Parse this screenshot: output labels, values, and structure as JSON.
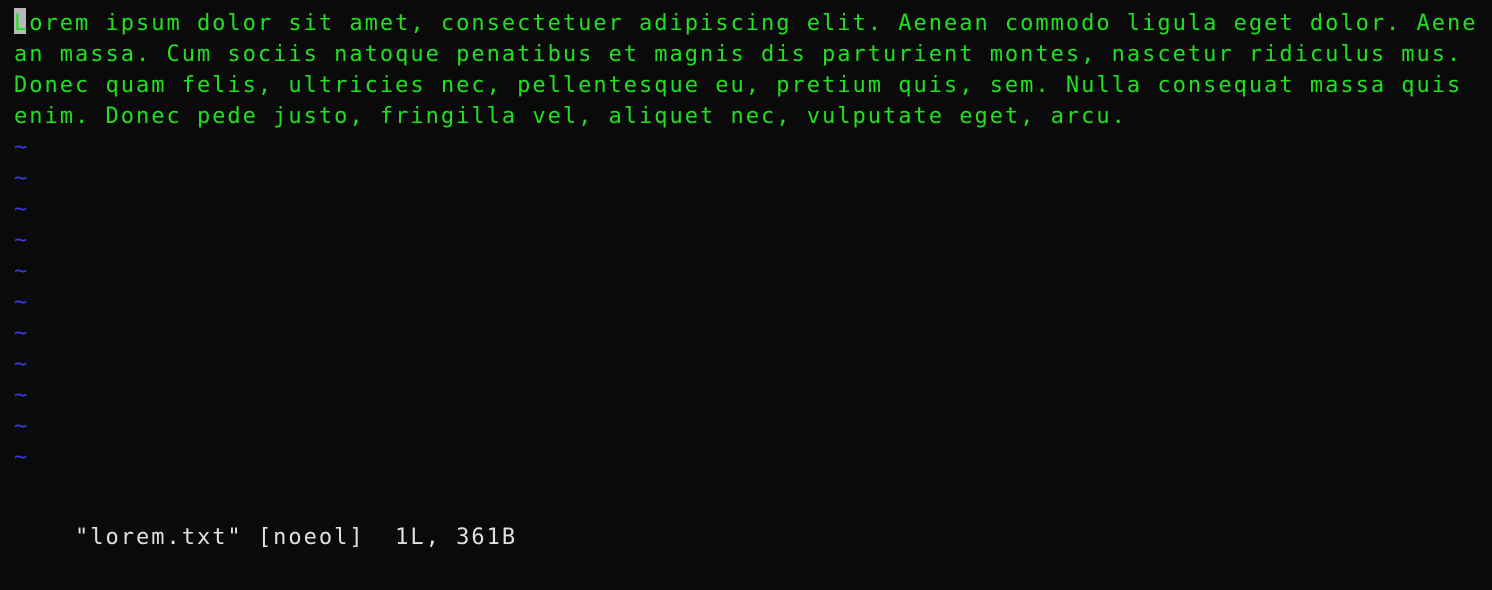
{
  "editor": {
    "buffer_text": "Lorem ipsum dolor sit amet, consectetuer adipiscing elit. Aenean commodo ligula eget dolor. Aenean massa. Cum sociis natoque penatibus et magnis dis parturient montes, nascetur ridiculus mus. Donec quam felis, ultricies nec, pellentesque eu, pretium quis, sem. Nulla consequat massa quis enim. Donec pede justo, fringilla vel, aliquet nec, vulputate eget, arcu.",
    "tilde": "~",
    "tilde_count": 11,
    "status": {
      "filename": "\"lorem.txt\"",
      "flags": "[noeol]",
      "lines": "1L,",
      "bytes": "361B"
    }
  },
  "colors": {
    "background": "#0a0a0a",
    "text": "#20e020",
    "tilde": "#3a3ae0",
    "status": "#e0e0e0",
    "cursor": "#d8d8d8"
  }
}
